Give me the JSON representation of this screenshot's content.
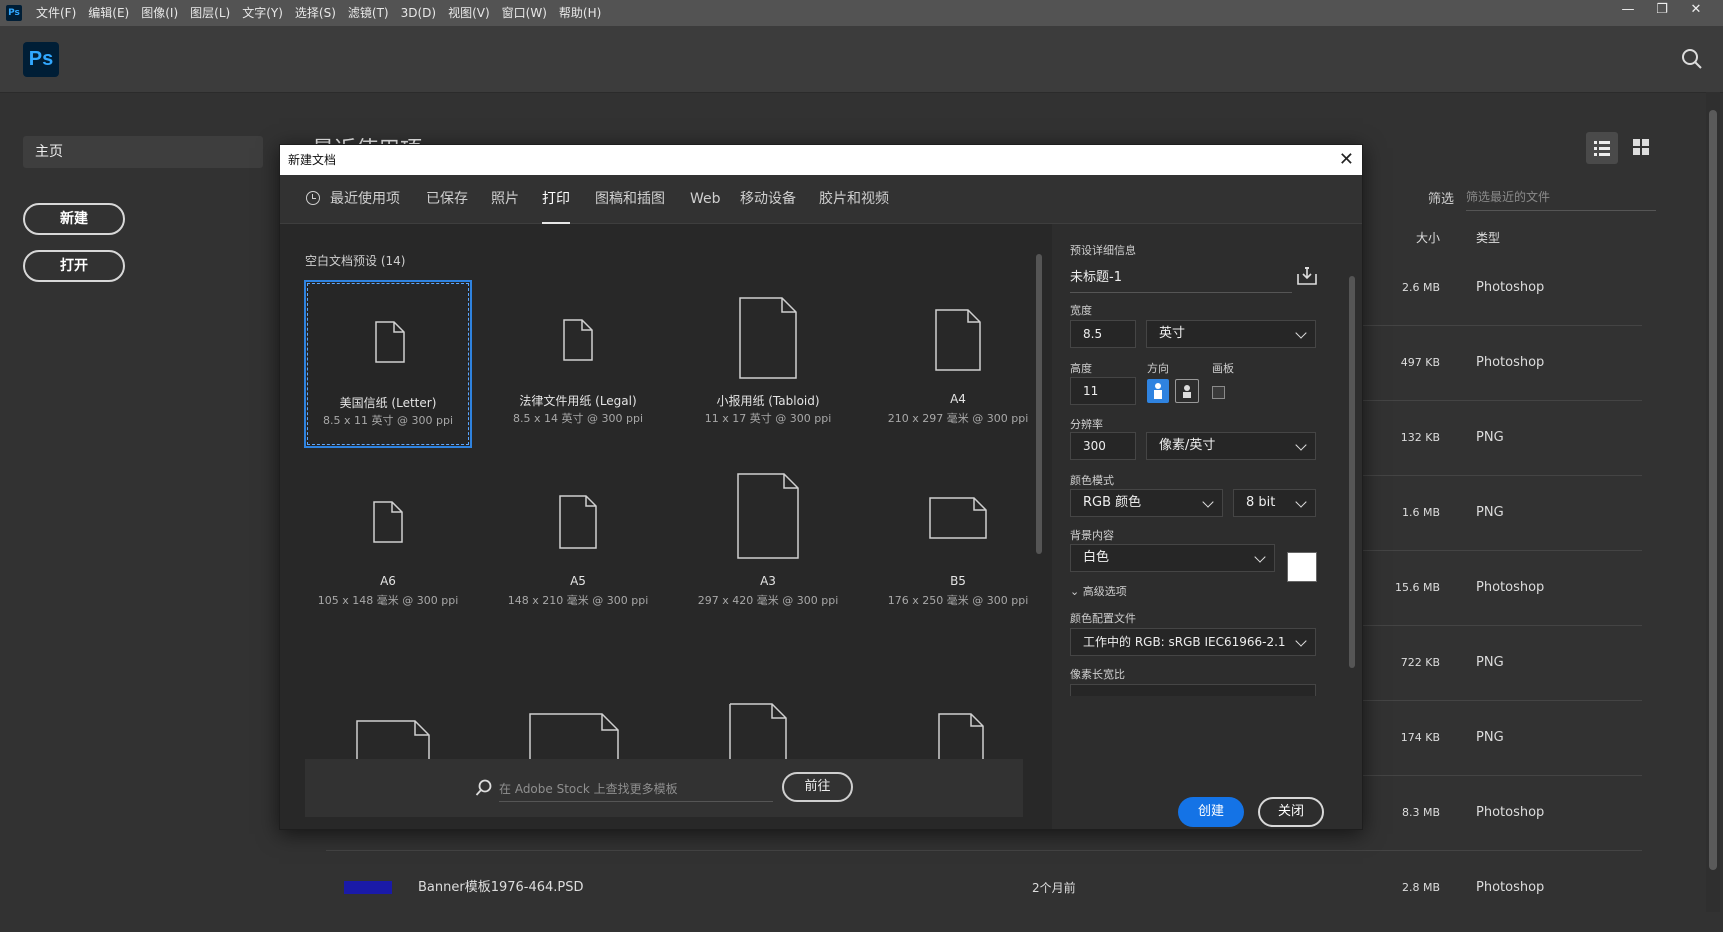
{
  "menubar": {
    "logo": "Ps",
    "items": [
      "文件(F)",
      "编辑(E)",
      "图像(I)",
      "图层(L)",
      "文字(Y)",
      "选择(S)",
      "滤镜(T)",
      "3D(D)",
      "视图(V)",
      "窗口(W)",
      "帮助(H)"
    ],
    "window_controls": [
      "—",
      "❐",
      "✕"
    ]
  },
  "header": {
    "logo": "Ps"
  },
  "nav": {
    "home": "主页",
    "new": "新建",
    "open": "打开"
  },
  "main": {
    "title": "最近使用项",
    "filter_label": "筛选",
    "filter_placeholder": "筛选最近的文件",
    "col_size": "大小",
    "col_type": "类型",
    "files": [
      {
        "size": "2.6 MB",
        "type": "Photoshop"
      },
      {
        "size": "497 KB",
        "type": "Photoshop"
      },
      {
        "size": "132 KB",
        "type": "PNG"
      },
      {
        "size": "1.6 MB",
        "type": "PNG"
      },
      {
        "size": "15.6 MB",
        "type": "Photoshop"
      },
      {
        "size": "722 KB",
        "type": "PNG"
      },
      {
        "size": "174 KB",
        "type": "PNG"
      },
      {
        "size": "8.3 MB",
        "type": "Photoshop"
      },
      {
        "name": "Banner模板1976-464.PSD",
        "date": "2个月前",
        "size": "2.8 MB",
        "type": "Photoshop"
      }
    ]
  },
  "dialog": {
    "title": "新建文档",
    "close": "✕",
    "tabs": [
      "最近使用项",
      "已保存",
      "照片",
      "打印",
      "图稿和插图",
      "Web",
      "移动设备",
      "胶片和视频"
    ],
    "active_tab": "打印",
    "presets_label": "空白文档预设",
    "presets_count": "(14)",
    "presets": [
      {
        "name": "美国信纸 (Letter)",
        "dim": "8.5 x 11 英寸 @ 300 ppi"
      },
      {
        "name": "法律文件用纸 (Legal)",
        "dim": "8.5 x 14 英寸 @ 300 ppi"
      },
      {
        "name": "小报用纸 (Tabloid)",
        "dim": "11 x 17 英寸 @ 300 ppi"
      },
      {
        "name": "A4",
        "dim": "210 x 297 毫米 @ 300 ppi"
      },
      {
        "name": "A6",
        "dim": "105 x 148 毫米 @ 300 ppi"
      },
      {
        "name": "A5",
        "dim": "148 x 210 毫米 @ 300 ppi"
      },
      {
        "name": "A3",
        "dim": "297 x 420 毫米 @ 300 ppi"
      },
      {
        "name": "B5",
        "dim": "176 x 250 毫米 @ 300 ppi"
      }
    ],
    "stock_placeholder": "在 Adobe Stock 上查找更多模板",
    "stock_go": "前往",
    "details": {
      "heading": "预设详细信息",
      "doc_name": "未标题-1",
      "width_label": "宽度",
      "width_value": "8.5",
      "width_unit": "英寸",
      "height_label": "高度",
      "height_value": "11",
      "orientation_label": "方向",
      "artboard_label": "画板",
      "resolution_label": "分辨率",
      "resolution_value": "300",
      "resolution_unit": "像素/英寸",
      "color_mode_label": "颜色模式",
      "color_mode": "RGB 颜色",
      "bit_depth": "8 bit",
      "background_label": "背景内容",
      "background": "白色",
      "advanced_label": "高级选项",
      "color_profile_label": "颜色配置文件",
      "color_profile": "工作中的 RGB: sRGB IEC61966-2.1",
      "pixel_aspect_label": "像素长宽比",
      "create": "创建",
      "close": "关闭"
    }
  }
}
